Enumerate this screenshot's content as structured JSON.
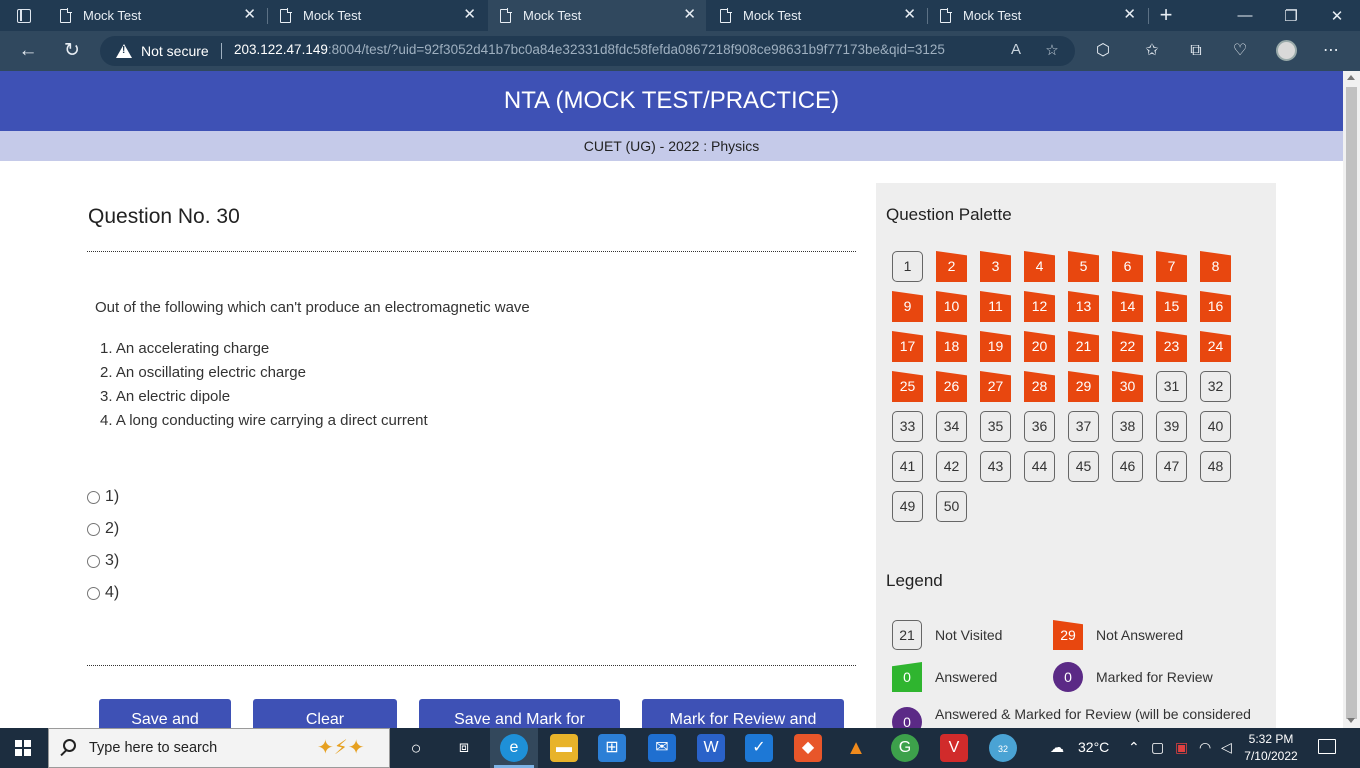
{
  "browser": {
    "tabs": [
      {
        "title": "Mock Test"
      },
      {
        "title": "Mock Test"
      },
      {
        "title": "Mock Test"
      },
      {
        "title": "Mock Test"
      },
      {
        "title": "Mock Test"
      }
    ],
    "active_tab_index": 2,
    "security_label": "Not secure",
    "url_host": "203.122.47.149",
    "url_rest": ":8004/test/?uid=92f3052d41b7bc0a84e32331d8fdc58fefda0867218f908ce98631b9f77173be&qid=3125"
  },
  "page": {
    "header_title": "NTA (MOCK TEST/PRACTICE)",
    "subheader": "CUET (UG) - 2022 : Physics"
  },
  "question": {
    "title": "Question No. 30",
    "text": "Out of the following which can't produce an electromagnetic wave",
    "options": [
      "1. An accelerating charge",
      "2. An oscillating electric charge",
      "3. An electric dipole",
      "4. A long conducting wire carrying a direct current"
    ],
    "choices": [
      "1)",
      "2)",
      "3)",
      "4)"
    ]
  },
  "buttons": {
    "save_next": "Save and",
    "clear": "Clear",
    "save_mark": "Save and Mark for",
    "mark_review": "Mark for Review and"
  },
  "palette": {
    "title": "Question Palette",
    "items": [
      {
        "n": "1",
        "status": "not-visited"
      },
      {
        "n": "2",
        "status": "not-answered"
      },
      {
        "n": "3",
        "status": "not-answered"
      },
      {
        "n": "4",
        "status": "not-answered"
      },
      {
        "n": "5",
        "status": "not-answered"
      },
      {
        "n": "6",
        "status": "not-answered"
      },
      {
        "n": "7",
        "status": "not-answered"
      },
      {
        "n": "8",
        "status": "not-answered"
      },
      {
        "n": "9",
        "status": "not-answered"
      },
      {
        "n": "10",
        "status": "not-answered"
      },
      {
        "n": "11",
        "status": "not-answered"
      },
      {
        "n": "12",
        "status": "not-answered"
      },
      {
        "n": "13",
        "status": "not-answered"
      },
      {
        "n": "14",
        "status": "not-answered"
      },
      {
        "n": "15",
        "status": "not-answered"
      },
      {
        "n": "16",
        "status": "not-answered"
      },
      {
        "n": "17",
        "status": "not-answered"
      },
      {
        "n": "18",
        "status": "not-answered"
      },
      {
        "n": "19",
        "status": "not-answered"
      },
      {
        "n": "20",
        "status": "not-answered"
      },
      {
        "n": "21",
        "status": "not-answered"
      },
      {
        "n": "22",
        "status": "not-answered"
      },
      {
        "n": "23",
        "status": "not-answered"
      },
      {
        "n": "24",
        "status": "not-answered"
      },
      {
        "n": "25",
        "status": "not-answered"
      },
      {
        "n": "26",
        "status": "not-answered"
      },
      {
        "n": "27",
        "status": "not-answered"
      },
      {
        "n": "28",
        "status": "not-answered"
      },
      {
        "n": "29",
        "status": "not-answered"
      },
      {
        "n": "30",
        "status": "not-answered"
      },
      {
        "n": "31",
        "status": "not-visited"
      },
      {
        "n": "32",
        "status": "not-visited"
      },
      {
        "n": "33",
        "status": "not-visited"
      },
      {
        "n": "34",
        "status": "not-visited"
      },
      {
        "n": "35",
        "status": "not-visited"
      },
      {
        "n": "36",
        "status": "not-visited"
      },
      {
        "n": "37",
        "status": "not-visited"
      },
      {
        "n": "38",
        "status": "not-visited"
      },
      {
        "n": "39",
        "status": "not-visited"
      },
      {
        "n": "40",
        "status": "not-visited"
      },
      {
        "n": "41",
        "status": "not-visited"
      },
      {
        "n": "42",
        "status": "not-visited"
      },
      {
        "n": "43",
        "status": "not-visited"
      },
      {
        "n": "44",
        "status": "not-visited"
      },
      {
        "n": "45",
        "status": "not-visited"
      },
      {
        "n": "46",
        "status": "not-visited"
      },
      {
        "n": "47",
        "status": "not-visited"
      },
      {
        "n": "48",
        "status": "not-visited"
      },
      {
        "n": "49",
        "status": "not-visited"
      },
      {
        "n": "50",
        "status": "not-visited"
      }
    ]
  },
  "legend": {
    "title": "Legend",
    "items": [
      {
        "count": "21",
        "label": "Not Visited",
        "status": "not-visited"
      },
      {
        "count": "29",
        "label": "Not Answered",
        "status": "not-answered"
      },
      {
        "count": "0",
        "label": "Answered",
        "status": "answered"
      },
      {
        "count": "0",
        "label": "Marked for Review",
        "status": "marked"
      },
      {
        "count": "0",
        "label": "Answered & Marked for Review (will be considered",
        "status": "answered-marked"
      }
    ]
  },
  "taskbar": {
    "search_placeholder": "Type here to search",
    "temperature": "32°C",
    "time": "5:32 PM",
    "date": "7/10/2022",
    "badge": "32"
  },
  "colors": {
    "header_blue": "#3e51b5",
    "subheader": "#c5cae9",
    "not_answered": "#e8470f",
    "answered": "#2fb52f",
    "marked": "#5b2a86"
  }
}
